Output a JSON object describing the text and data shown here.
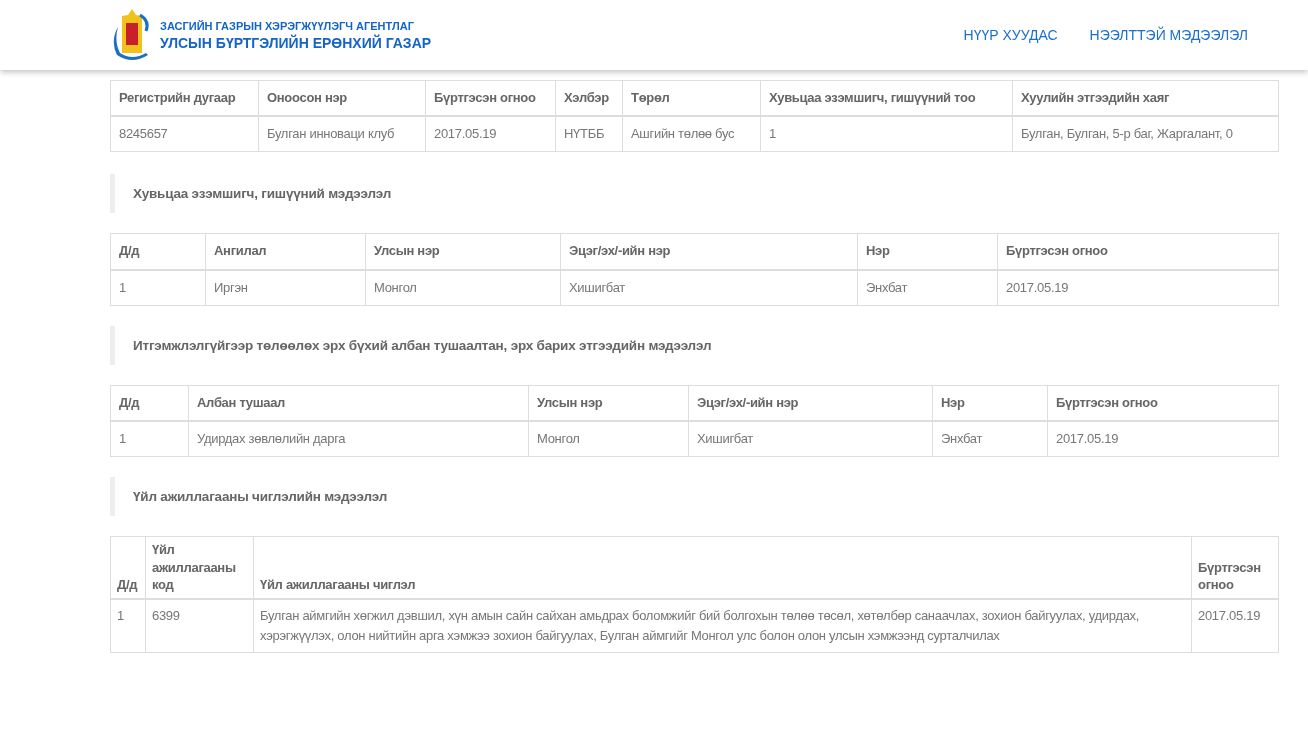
{
  "header": {
    "agency_line": "ЗАСГИЙН ГАЗРЫН ХЭРЭГЖҮҮЛЭГЧ АГЕНТЛАГ",
    "office_line": "УЛСЫН БҮРТГЭЛИЙН ЕРӨНХИЙ ГАЗАР",
    "nav": [
      {
        "label": "НҮҮР ХУУДАС"
      },
      {
        "label": "НЭЭЛТТЭЙ МЭДЭЭЛЭЛ"
      }
    ]
  },
  "company_table": {
    "columns": [
      "Регистрийн дугаар",
      "Оноосон нэр",
      "Бүртгэсэн огноо",
      "Хэлбэр",
      "Төрөл",
      "Хувьцаа эзэмшигч, гишүүний тоо",
      "Хуулийн этгээдийн хаяг"
    ],
    "rows": [
      [
        "8245657",
        "Булган инноваци клуб",
        "2017.05.19",
        "НҮТББ",
        "Ашгийн төлөө бус",
        "1",
        "Булган, Булган, 5-р баг, Жаргалант, 0"
      ]
    ]
  },
  "sections": [
    {
      "title": "Хувьцаа эзэмшигч, гишүүний мэдээлэл",
      "columns": [
        "Д/д",
        "Ангилал",
        "Улсын нэр",
        "Эцэг/эх/-ийн нэр",
        "Нэр",
        "Бүртгэсэн огноо"
      ],
      "rows": [
        [
          "1",
          "Иргэн",
          "Монгол",
          "Хишигбат",
          "Энхбат",
          "2017.05.19"
        ]
      ]
    },
    {
      "title": "Итгэмжлэлгүйгээр төлөөлөх эрх бүхий албан тушаалтан, эрх барих этгээдийн мэдээлэл",
      "columns": [
        "Д/д",
        "Албан тушаал",
        "Улсын нэр",
        "Эцэг/эх/-ийн нэр",
        "Нэр",
        "Бүртгэсэн огноо"
      ],
      "rows": [
        [
          "1",
          "Удирдах зөвлөлийн дарга",
          "Монгол",
          "Хишигбат",
          "Энхбат",
          "2017.05.19"
        ]
      ]
    },
    {
      "title": "Үйл ажиллагааны чиглэлийн мэдээлэл",
      "columns": [
        "Д/д",
        "Үйл ажиллагааны код",
        "Үйл ажиллагааны чиглэл",
        "Бүртгэсэн огноо"
      ],
      "rows": [
        [
          "1",
          "6399",
          "Булган аймгийн хөгжил дэвшил, хүн амын сайн сайхан амьдрах боломжийг бий болгохын төлөө төсөл, хөтөлбөр санаачлах, зохион байгуулах, удирдах, хэрэгжүүлэх, олон нийтийн арга хэмжээ зохион байгуулах, Булган аймгийг Монгол улс болон олон улсын хэмжээнд сурталчилах",
          "2017.05.19"
        ]
      ]
    }
  ]
}
